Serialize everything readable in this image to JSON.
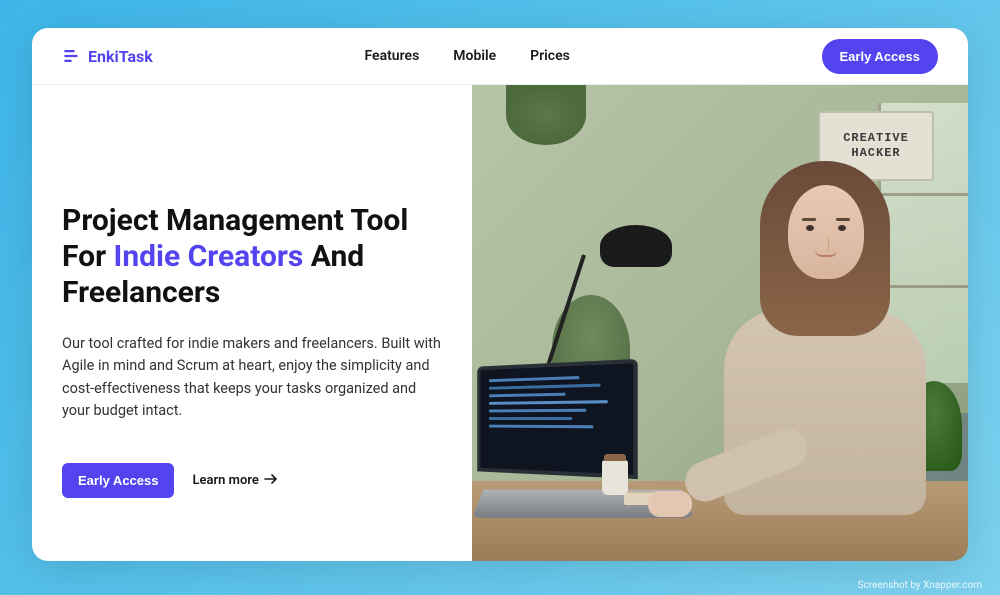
{
  "brand": "EnkiTask",
  "nav": {
    "items": [
      {
        "label": "Features"
      },
      {
        "label": "Mobile"
      },
      {
        "label": "Prices"
      }
    ],
    "cta": "Early Access"
  },
  "hero": {
    "title_pre": "Project Management Tool For ",
    "title_highlight": "Indie Creators",
    "title_post": " And Freelancers",
    "description": "Our tool crafted for indie makers and freelancers. Built with Agile in mind and Scrum at heart, enjoy the simplicity and cost-effectiveness that keeps your tasks organized and your budget intact.",
    "cta_primary": "Early Access",
    "cta_secondary": "Learn more",
    "poster_text": "CREATIVE HACKER"
  },
  "watermark": "Screenshot by Xnapper.com"
}
